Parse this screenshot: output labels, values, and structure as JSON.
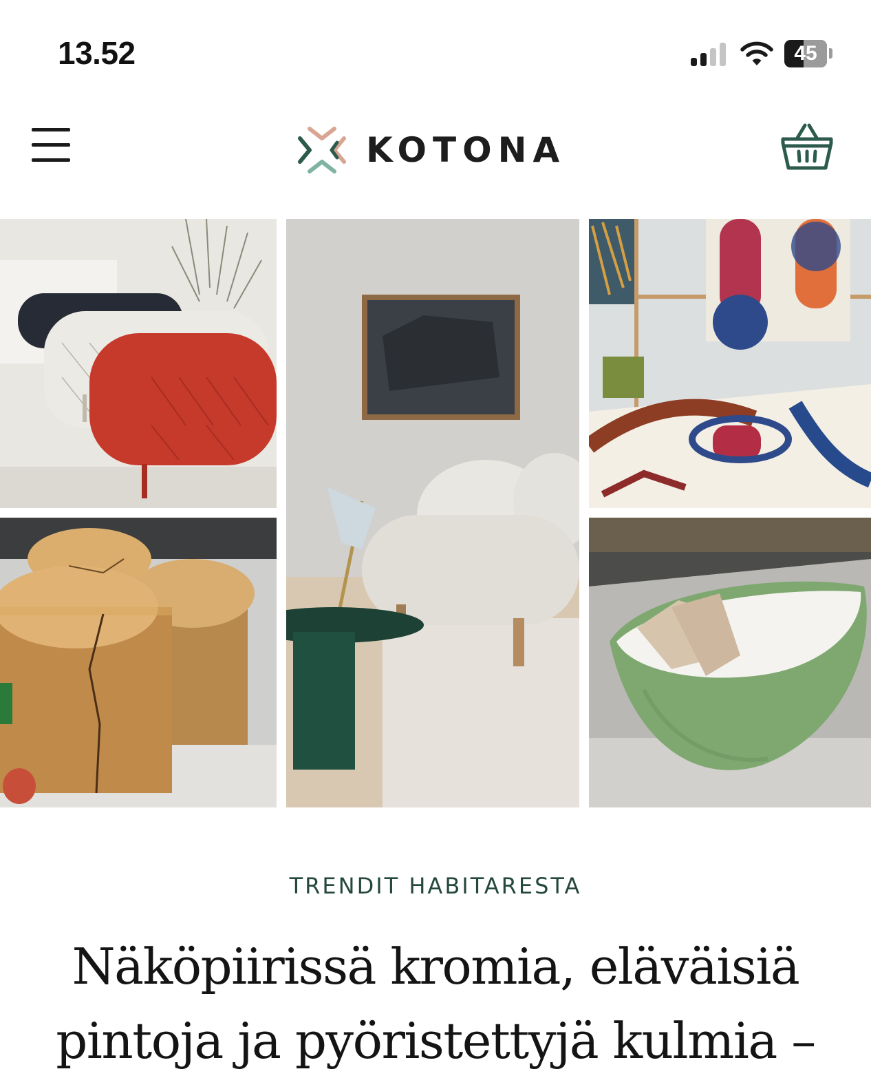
{
  "status_bar": {
    "time": "13.52",
    "battery_level": "45",
    "battery_fraction": 0.45,
    "signal_bars_active": 2,
    "signal_bars_total": 4
  },
  "header": {
    "brand": "KOTONA",
    "menu_icon": "hamburger-menu-icon",
    "cart_icon": "shopping-basket-icon",
    "brand_color": "#2c5a4c",
    "logo_accent_color": "#d9a593"
  },
  "gallery": {
    "images": [
      "sideboards-image",
      "boucle-sofa-image",
      "quilt-bedroom-image",
      "wooden-stools-image",
      "green-bathtub-image"
    ]
  },
  "article": {
    "category": "TRENDIT HABITARESTA",
    "headline_line1": "Näköpiirissä kromia, eläväisiä",
    "headline_line2": "pintoja ja pyöristettyjä kulmia –",
    "category_color": "#24493b"
  }
}
